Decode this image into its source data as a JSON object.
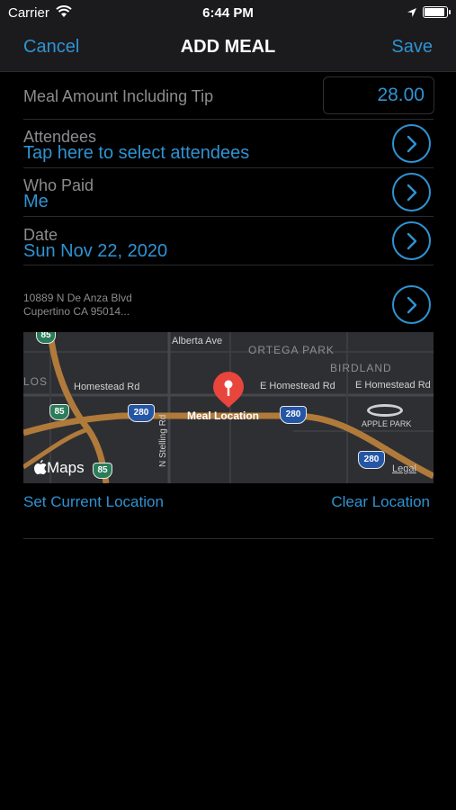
{
  "status": {
    "carrier": "Carrier",
    "time": "6:44 PM"
  },
  "nav": {
    "cancel": "Cancel",
    "title": "ADD MEAL",
    "save": "Save"
  },
  "form": {
    "amount_label": "Meal Amount Including Tip",
    "amount_value": "28.00",
    "attendees_label": "Attendees",
    "attendees_value": "Tap here to select attendees",
    "who_paid_label": "Who Paid",
    "who_paid_value": "Me",
    "date_label": "Date",
    "date_value": "Sun Nov 22, 2020",
    "address_line1": "10889 N De Anza Blvd",
    "address_line2": "Cupertino CA 95014..."
  },
  "map": {
    "pin_label": "Meal Location",
    "streets": [
      "Alberta Ave",
      "Homestead Rd",
      "E Homestead Rd",
      "E Homestead Rd",
      "N Stelling Rd"
    ],
    "areas": [
      "ORTEGA PARK",
      "BIRDLAND",
      "LOS",
      "APPLE PARK"
    ],
    "highway_shields": [
      "85",
      "85",
      "85",
      "280",
      "280",
      "280"
    ],
    "brand": "Maps",
    "legal": "Legal"
  },
  "actions": {
    "set_location": "Set Current Location",
    "clear_location": "Clear Location"
  },
  "colors": {
    "accent": "#2f93d3",
    "background": "#000000",
    "pin": "#e8453c"
  }
}
